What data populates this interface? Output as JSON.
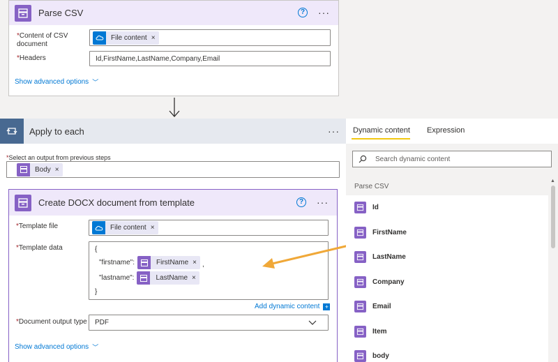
{
  "colors": {
    "accent_purple": "#8661c5",
    "accent_blue": "#0078d4",
    "link": "#0078d4",
    "arrow": "#f0a838",
    "loop_blue": "#486991"
  },
  "parse_csv": {
    "title": "Parse CSV",
    "help_icon": "?",
    "more_icon": "···",
    "content_label": "Content of CSV document",
    "content_token": "File content",
    "headers_label": "Headers",
    "headers_value": "Id,FirstName,LastName,Company,Email",
    "advanced": "Show advanced options",
    "required_mark": "*"
  },
  "apply_each": {
    "title": "Apply to each",
    "more_icon": "···",
    "select_label": "Select an output from previous steps",
    "body_token": "Body",
    "required_mark": "*"
  },
  "create_docx": {
    "title": "Create DOCX document from template",
    "help_icon": "?",
    "more_icon": "···",
    "template_file_label": "Template file",
    "template_file_token": "File content",
    "template_data_label": "Template data",
    "json_open": "{",
    "firstname_key": "\"firstname\":",
    "firstname_token": "FirstName",
    "comma": ",",
    "lastname_key": "\"lastname\":",
    "lastname_token": "LastName",
    "json_close": "}",
    "add_dynamic": "Add dynamic content",
    "output_type_label": "Document output type",
    "output_type_value": "PDF",
    "advanced": "Show advanced options",
    "required_mark": "*",
    "remove_icon": "×"
  },
  "panel": {
    "tabs": [
      "Dynamic content",
      "Expression"
    ],
    "search_placeholder": "Search dynamic content",
    "section": "Parse CSV",
    "items": [
      "Id",
      "FirstName",
      "LastName",
      "Company",
      "Email",
      "Item",
      "body"
    ]
  }
}
